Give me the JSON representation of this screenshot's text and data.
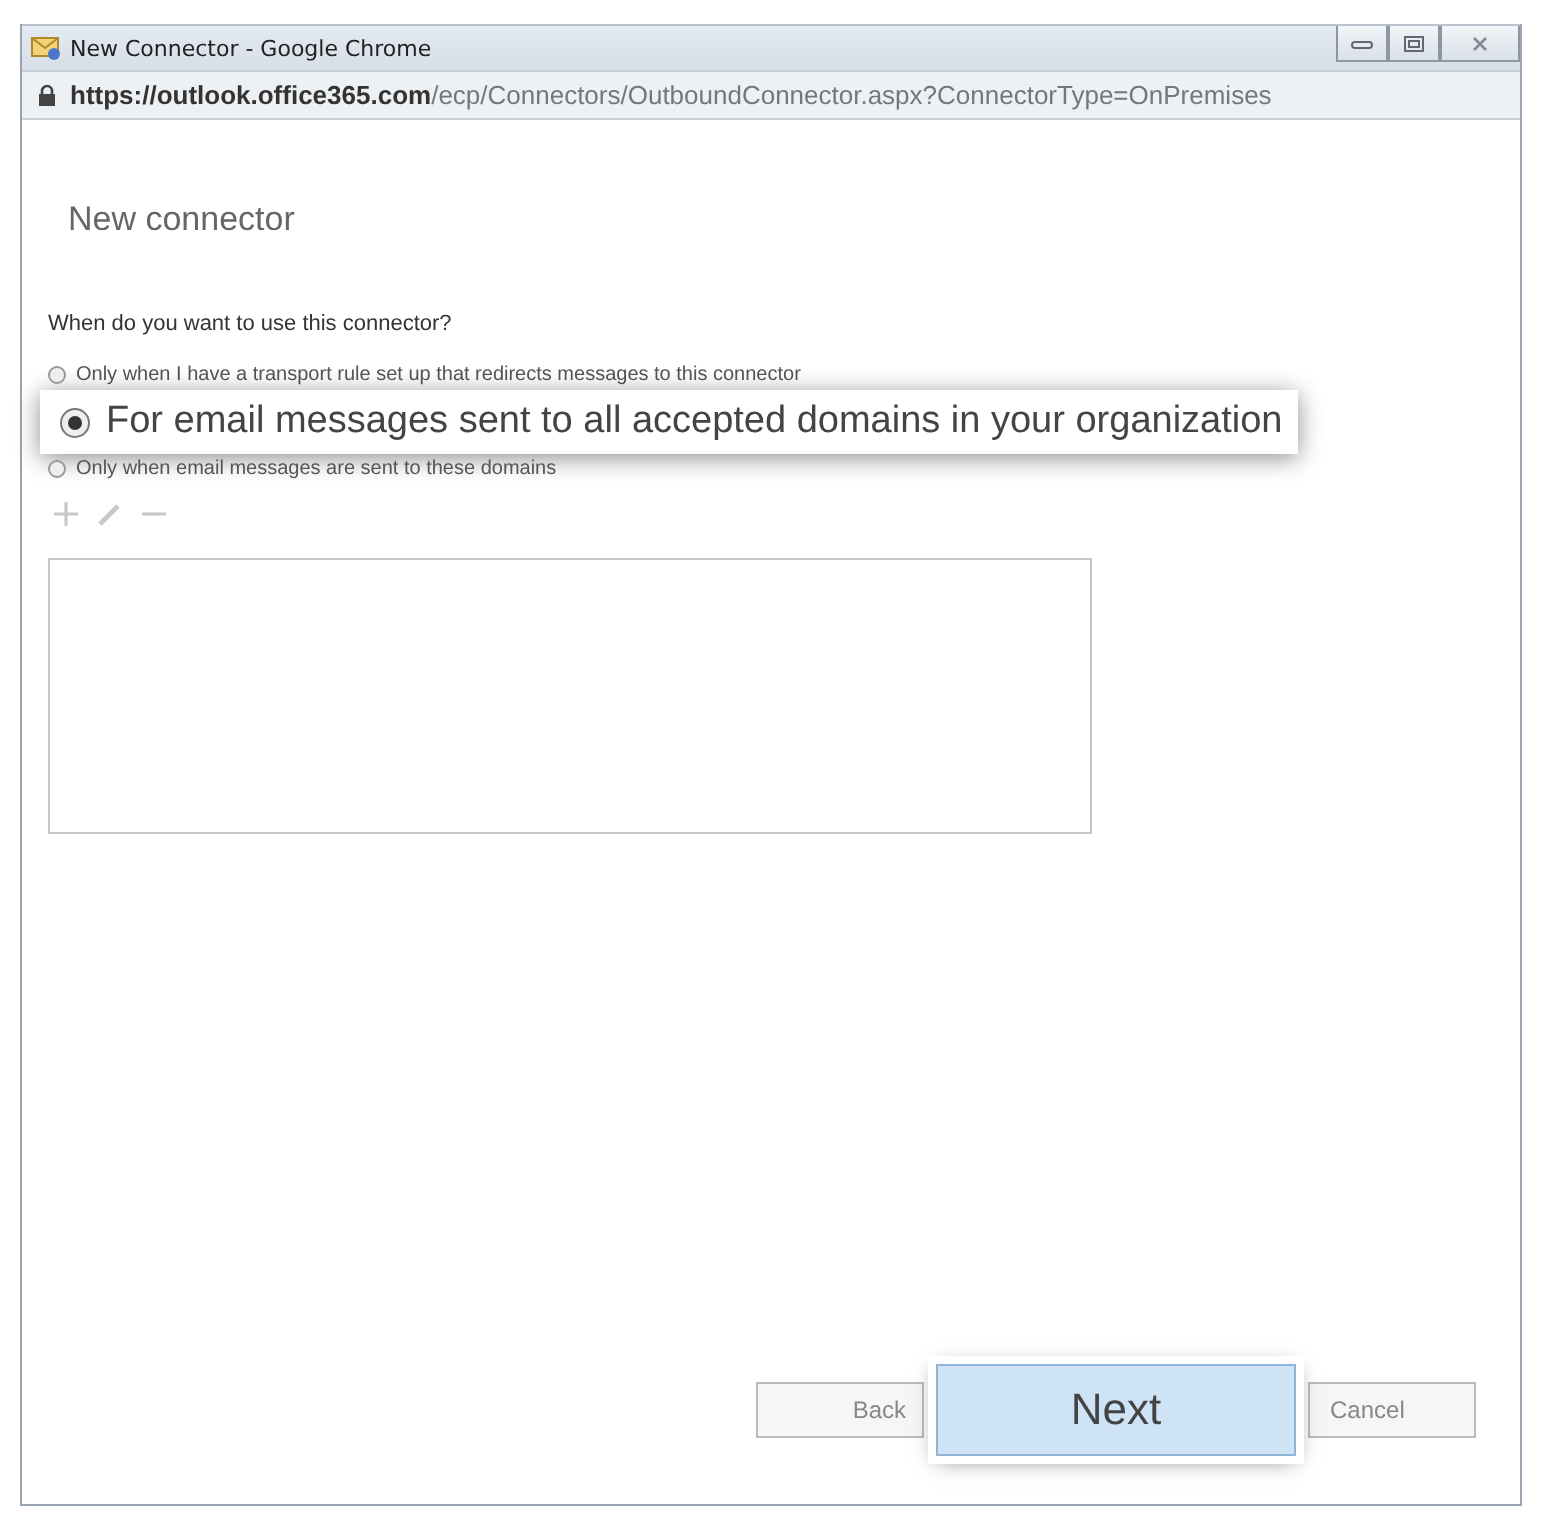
{
  "window": {
    "title": "New Connector - Google Chrome"
  },
  "address_bar": {
    "host": "https://outlook.office365.com",
    "path": "/ecp/Connectors/OutboundConnector.aspx?ConnectorType=OnPremises"
  },
  "page_title": "New connector",
  "question": "When do you want to use this connector?",
  "options": [
    {
      "label": "Only when I have a transport rule set up that redirects messages to this connector",
      "selected": false,
      "magnified": false
    },
    {
      "label": "For email messages sent to all accepted domains in your organization",
      "selected": true,
      "magnified": true
    },
    {
      "label": "Only when email messages are sent to these domains",
      "selected": false,
      "magnified": false
    }
  ],
  "toolbar": [
    {
      "kind": "add",
      "disabled": true
    },
    {
      "kind": "edit",
      "disabled": true
    },
    {
      "kind": "remove",
      "disabled": true
    }
  ],
  "buttons": [
    {
      "label": "Back",
      "magnified": false
    },
    {
      "label": "Next",
      "magnified": true
    },
    {
      "label": "Cancel",
      "magnified": false
    }
  ]
}
